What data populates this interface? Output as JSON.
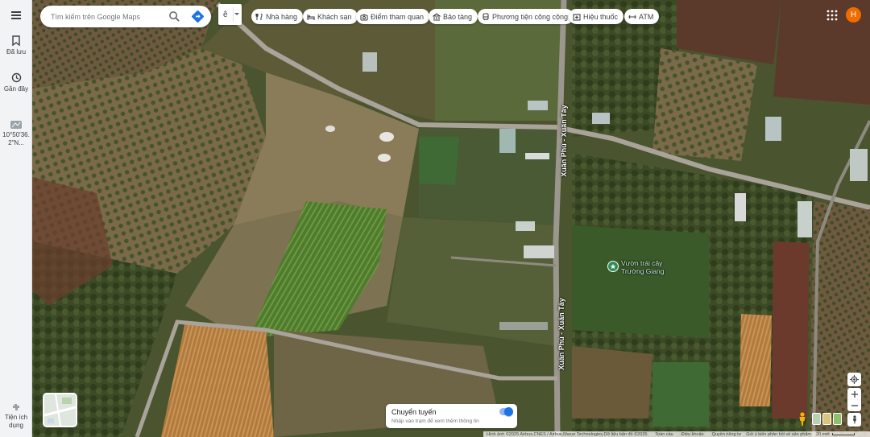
{
  "search": {
    "placeholder": "Tìm kiếm trên Google Maps"
  },
  "language": {
    "label": "ê"
  },
  "chips": [
    {
      "label": "Nhà hàng",
      "icon": "fork-knife-icon"
    },
    {
      "label": "Khách sạn",
      "icon": "bed-icon"
    },
    {
      "label": "Điểm tham quan",
      "icon": "camera-icon"
    },
    {
      "label": "Bảo tàng",
      "icon": "museum-icon"
    },
    {
      "label": "Phương tiện công cộng",
      "icon": "train-icon"
    },
    {
      "label": "Hiệu thuốc",
      "icon": "pharmacy-icon"
    },
    {
      "label": "ATM",
      "icon": "atm-icon"
    }
  ],
  "avatar": {
    "initial": "H",
    "color": "#ef6c00"
  },
  "sidebar": {
    "saved_label": "Đã lưu",
    "recent_label": "Gần đây",
    "coordinates_label": "10°50'36.2\"N...",
    "bottom_label": "Tiện ích dụng"
  },
  "map": {
    "road_label_1": "Xuân Phú - Xuân Tây",
    "road_label_2": "Xuân Phú - Xuân Tây",
    "poi_name": "Vườn trái cây Trường Giang"
  },
  "transit": {
    "title": "Chuyển tuyến",
    "subtitle": "Nhấp vào trạm để xem thêm thông tin",
    "enabled": true
  },
  "attribution": {
    "imagery": "Hình ảnh ©2025 Airbus,CNES / Airbus,Maxar Technologies,Dữ liệu bản đồ ©2025",
    "global": "Toàn cầu",
    "terms": "Điều khoản",
    "privacy": "Quyền riêng tư",
    "feedback": "Gửi ý kiến phản hồi về sản phẩm",
    "scale": "20 mét"
  }
}
